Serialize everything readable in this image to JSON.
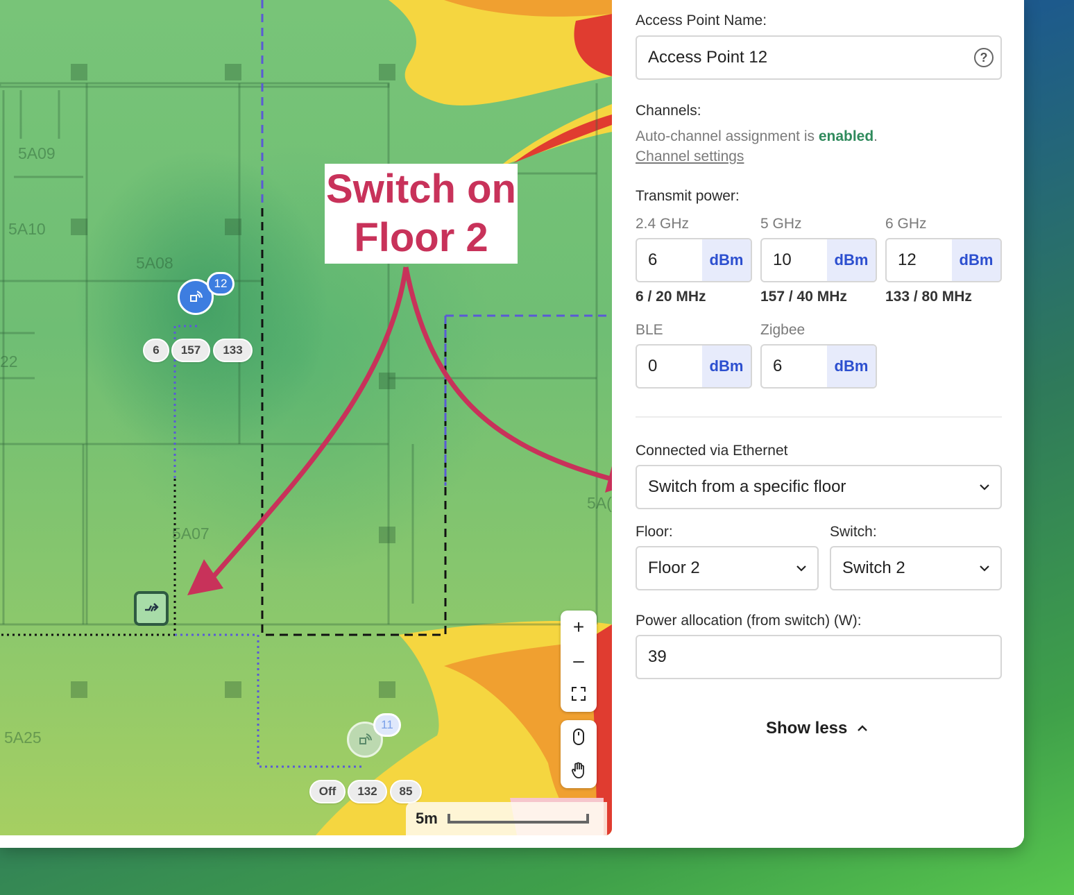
{
  "map": {
    "room_labels": [
      "5A09",
      "5A10",
      "5A08",
      "22",
      "5A07",
      "5A25",
      "5A("
    ],
    "annotation": {
      "line1": "Switch on",
      "line2": "Floor 2"
    },
    "access_points": [
      {
        "number": "12",
        "chips": [
          "6",
          "157",
          "133"
        ]
      },
      {
        "number": "11",
        "chips": [
          "Off",
          "132",
          "85"
        ]
      }
    ],
    "controls": {
      "zoom_in": "+",
      "zoom_out": "–",
      "fullscreen": "⛶",
      "mouse": "◯",
      "hand": "✋"
    },
    "scale_label": "5m"
  },
  "panel": {
    "ap_name_label": "Access Point Name:",
    "ap_name_value": "Access Point 12",
    "help_glyph": "?",
    "channels_label": "Channels:",
    "auto_channel_text": "Auto-channel assignment is ",
    "auto_channel_status": "enabled",
    "auto_channel_period": ".",
    "channel_settings_link": "Channel settings",
    "transmit_power_label": "Transmit power:",
    "bands": [
      {
        "label": "2.4 GHz",
        "value": "6",
        "unit": "dBm",
        "channel": "6 / 20 MHz"
      },
      {
        "label": "5 GHz",
        "value": "10",
        "unit": "dBm",
        "channel": "157 / 40 MHz"
      },
      {
        "label": "6 GHz",
        "value": "12",
        "unit": "dBm",
        "channel": "133 / 80 MHz"
      },
      {
        "label": "BLE",
        "value": "0",
        "unit": "dBm"
      },
      {
        "label": "Zigbee",
        "value": "6",
        "unit": "dBm"
      }
    ],
    "ethernet_label": "Connected via Ethernet",
    "ethernet_value": "Switch from a specific floor",
    "floor_label": "Floor:",
    "floor_value": "Floor 2",
    "switch_label": "Switch:",
    "switch_value": "Switch 2",
    "power_label": "Power allocation (from switch) (W):",
    "power_value": "39",
    "show_less": "Show less"
  },
  "colors": {
    "accent": "#c8325a",
    "unit_blue": "#2c4fcf",
    "enabled_green": "#2f8a5c",
    "ap_blue": "#3d7de0"
  }
}
